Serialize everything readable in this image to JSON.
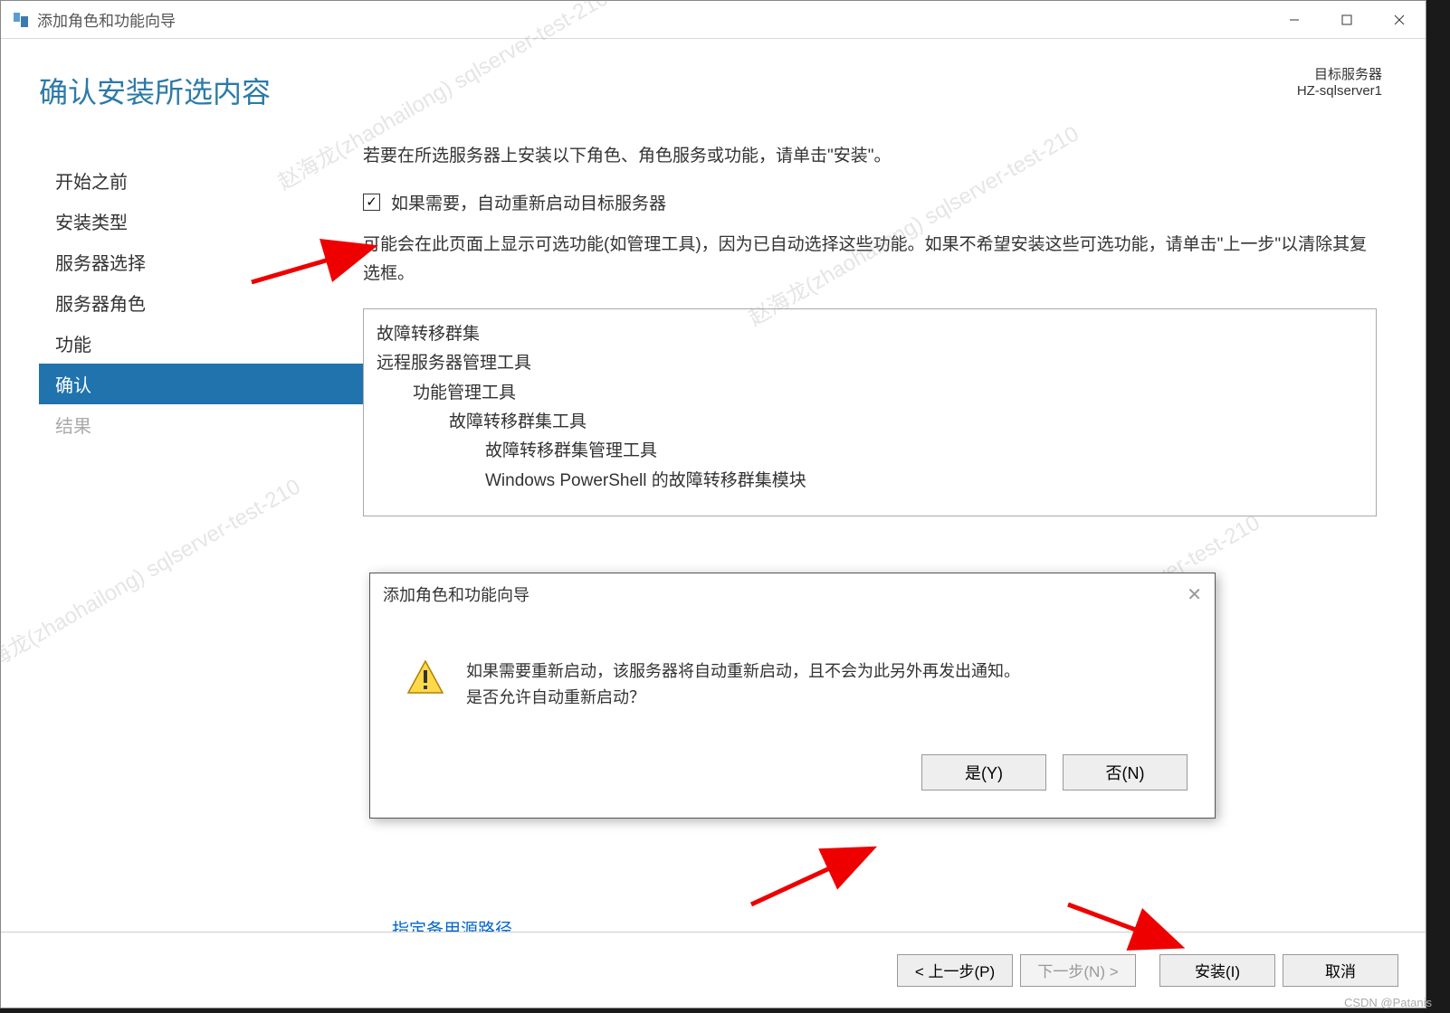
{
  "titlebar": {
    "title": "添加角色和功能向导"
  },
  "header": {
    "page_title": "确认安装所选内容",
    "target_label": "目标服务器",
    "target_name": "HZ-sqlserver1"
  },
  "sidebar": {
    "items": [
      {
        "label": "开始之前",
        "state": "normal"
      },
      {
        "label": "安装类型",
        "state": "normal"
      },
      {
        "label": "服务器选择",
        "state": "normal"
      },
      {
        "label": "服务器角色",
        "state": "normal"
      },
      {
        "label": "功能",
        "state": "normal"
      },
      {
        "label": "确认",
        "state": "selected"
      },
      {
        "label": "结果",
        "state": "disabled"
      }
    ]
  },
  "main": {
    "instruction": "若要在所选服务器上安装以下角色、角色服务或功能，请单击\"安装\"。",
    "checkbox_label": "如果需要，自动重新启动目标服务器",
    "optional_text": "可能会在此页面上显示可选功能(如管理工具)，因为已自动选择这些功能。如果不希望安装这些可选功能，请单击\"上一步\"以清除其复选框。",
    "features": [
      {
        "text": "故障转移群集",
        "indent": 0
      },
      {
        "text": "远程服务器管理工具",
        "indent": 0
      },
      {
        "text": "功能管理工具",
        "indent": 1
      },
      {
        "text": "故障转移群集工具",
        "indent": 2
      },
      {
        "text": "故障转移群集管理工具",
        "indent": 3
      },
      {
        "text": "Windows PowerShell 的故障转移群集模块",
        "indent": 3
      }
    ],
    "alternate_link": "指定备用源路径"
  },
  "dialog": {
    "title": "添加角色和功能向导",
    "line1": "如果需要重新启动，该服务器将自动重新启动，且不会为此另外再发出通知。",
    "line2": "是否允许自动重新启动？",
    "yes": "是(Y)",
    "no": "否(N)"
  },
  "footer": {
    "prev": "< 上一步(P)",
    "next": "下一步(N) >",
    "install": "安装(I)",
    "cancel": "取消"
  },
  "watermark_text": "赵海龙(zhaohailong) sqlserver-test-210",
  "credit": "CSDN @Patanis"
}
